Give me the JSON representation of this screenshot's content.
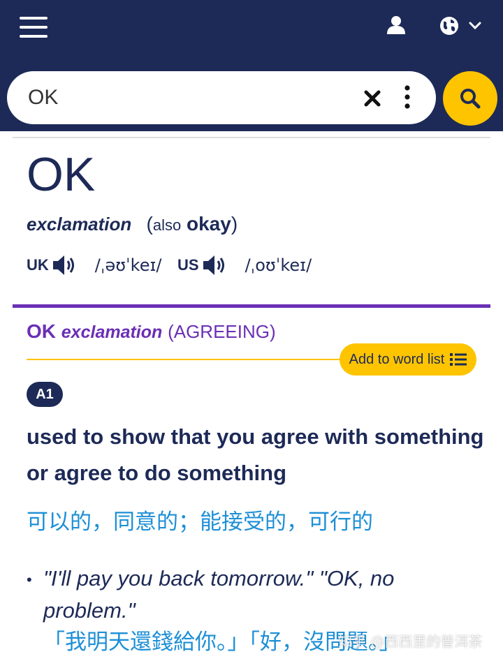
{
  "header": {
    "menu_icon": "hamburger-menu-icon",
    "user_icon": "user-icon",
    "language_icon": "globe-icon",
    "language_chevron": "chevron-down-icon",
    "bg_color": "#1d2a57"
  },
  "search": {
    "value": "OK",
    "clear_icon": "close-icon",
    "more_icon": "more-vertical-icon",
    "search_icon": "search-icon",
    "button_color": "#fec400"
  },
  "entry": {
    "headword": "OK",
    "part_of_speech": "exclamation",
    "also_label": "also",
    "alt_form": "okay",
    "pronunciations": [
      {
        "region": "UK",
        "ipa": "/ˌəʊˈkeɪ/"
      },
      {
        "region": "US",
        "ipa": "/ˌoʊˈkeɪ/"
      }
    ]
  },
  "sense": {
    "headword": "OK",
    "part_of_speech": "exclamation",
    "guideword": "(AGREEING)",
    "add_to_list_label": "Add to word list",
    "level": "A1",
    "definition": "used to show that you agree with something or agree to do something",
    "translation": "可以的，同意的；能接受的，可行的",
    "example": "\"I'll pay you back tomorrow.\" \"OK, no problem.\"",
    "example_translation": "「我明天還錢給你。」「好，沒問題。」",
    "accent_color": "#6b2fb5",
    "translation_color": "#1d8fd6"
  },
  "watermark": "知乎 @西西里的普洱茶"
}
